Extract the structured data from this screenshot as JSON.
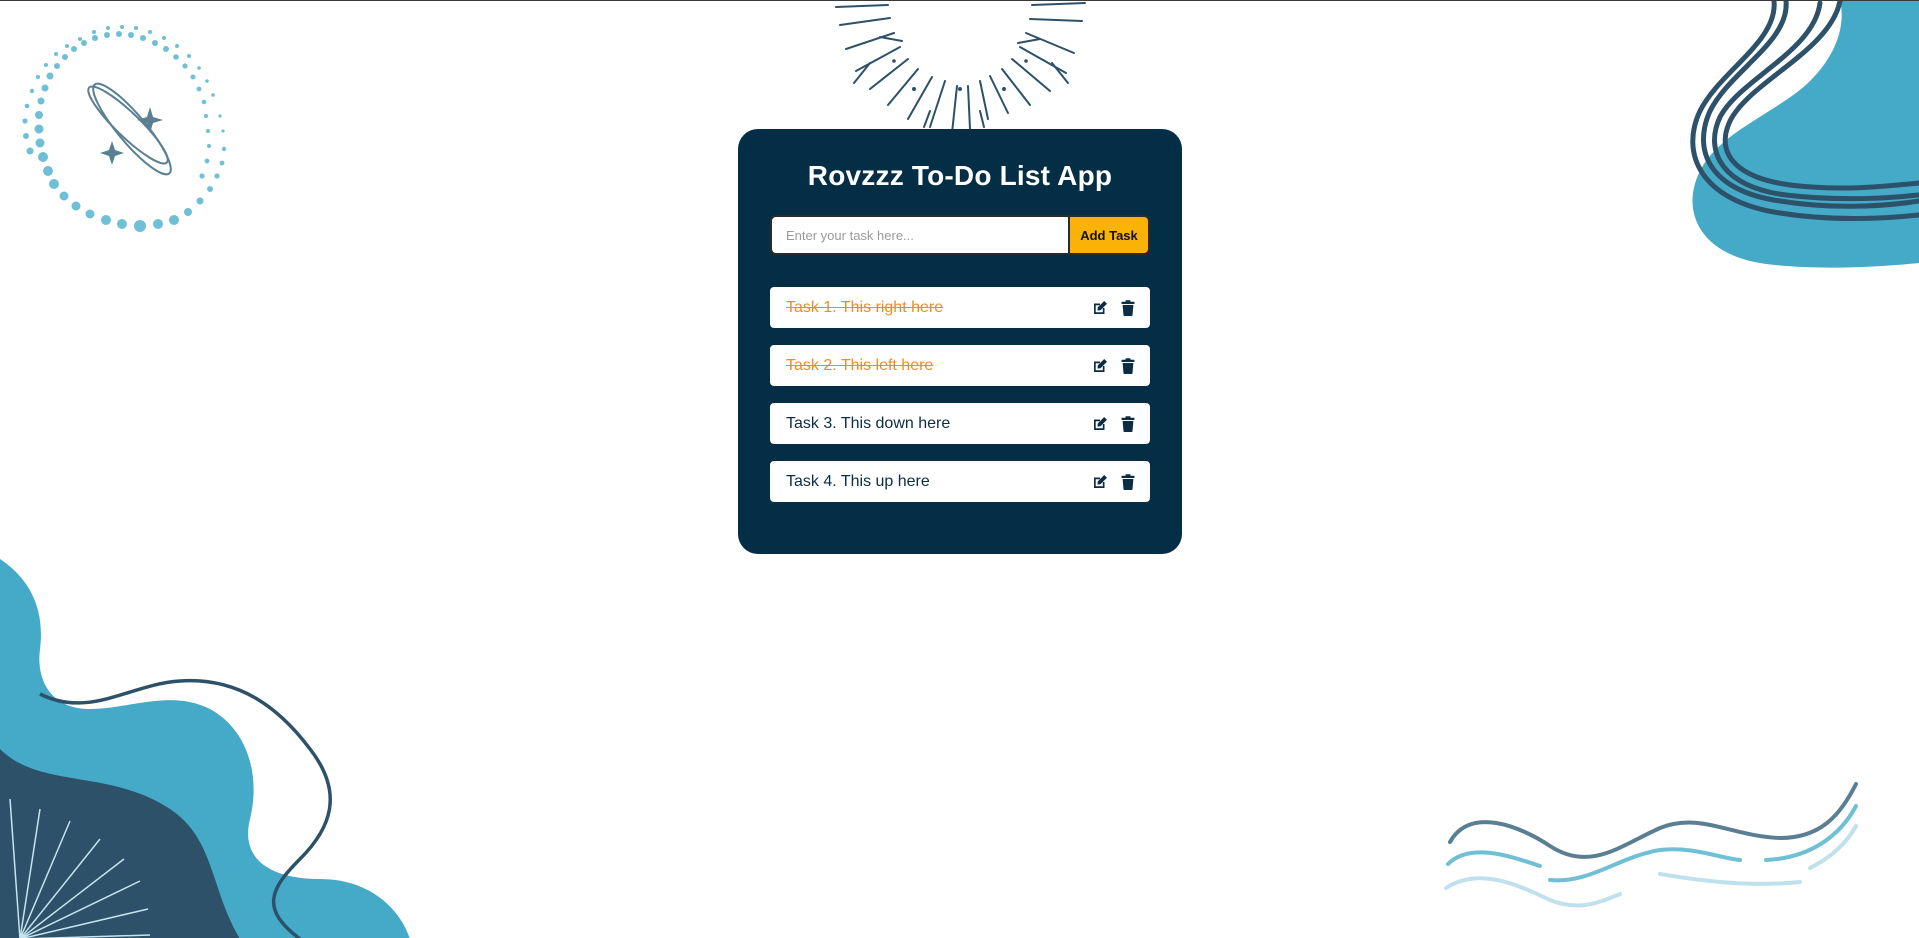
{
  "app": {
    "title": "Rovzzz To-Do List App"
  },
  "input": {
    "placeholder": "Enter your task here...",
    "value": ""
  },
  "add_button": {
    "label": "Add Task"
  },
  "tasks": [
    {
      "text": "Task 1. This right here",
      "completed": true
    },
    {
      "text": "Task 2. This left here",
      "completed": true
    },
    {
      "text": "Task 3. This down here",
      "completed": false
    },
    {
      "text": "Task 4. This up here",
      "completed": false
    }
  ],
  "icons": {
    "edit": "edit-icon",
    "delete": "trash-icon"
  },
  "colors": {
    "card_background": "#032e45",
    "accent_button": "#f9b208",
    "completed_text": "#f28c1e",
    "decor_light_blue": "#45a9c8",
    "decor_dark_blue": "#2c5168"
  }
}
